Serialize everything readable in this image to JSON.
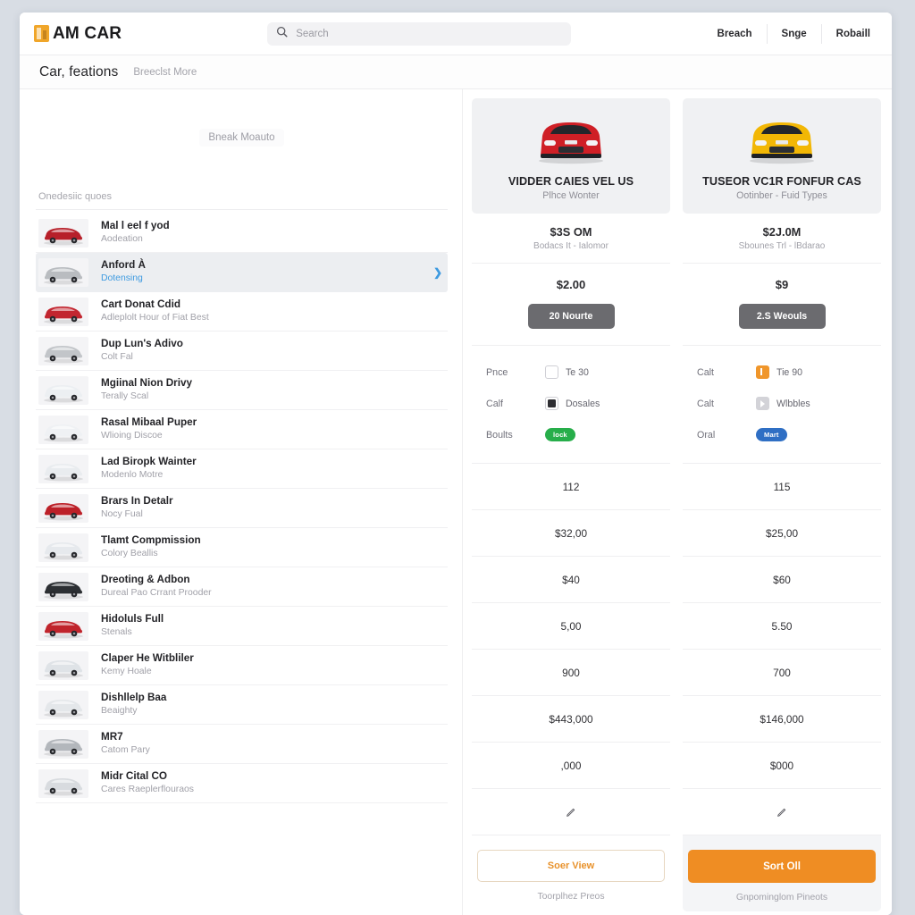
{
  "header": {
    "brand": "AM CAR",
    "brand_mark_color": "#f0a62a",
    "search_placeholder": "Search",
    "search_value": "",
    "nav": [
      {
        "label": "Breach"
      },
      {
        "label": "Snge"
      },
      {
        "label": "Robaill"
      }
    ]
  },
  "subheader": {
    "title": "Car, feations",
    "link": "Breeclst More"
  },
  "left_panel": {
    "hero_chip": "Bneak Moauto",
    "section_label": "Onedesiic quoes",
    "cars": [
      {
        "title": "Mal l eel f yod",
        "sub": "Aodeation",
        "color": "#b7202a",
        "selected": false,
        "link": false
      },
      {
        "title": "Anford À",
        "sub": "Dotensing",
        "color": "#b9bcc0",
        "selected": true,
        "link": true
      },
      {
        "title": "Cart Donat Cdid",
        "sub": "Adleplolt Hour of Fiat Best",
        "color": "#c22630",
        "selected": false,
        "link": false
      },
      {
        "title": "Dup Lun's Adivo",
        "sub": "Colt Fal",
        "color": "#c2c5c9",
        "selected": false,
        "link": false
      },
      {
        "title": "Mgiinal Nion Drivy",
        "sub": "Terally Scal",
        "color": "#eceff2",
        "selected": false,
        "link": false
      },
      {
        "title": "Rasal Mibaal Puper",
        "sub": "Wlioing Discoe",
        "color": "#eff1f4",
        "selected": false,
        "link": false
      },
      {
        "title": "Lad Biropk Wainter",
        "sub": "Modenlo Motre",
        "color": "#e9ecef",
        "selected": false,
        "link": false
      },
      {
        "title": "Brars In Detalr",
        "sub": "Nocy Fual",
        "color": "#bc2028",
        "selected": false,
        "link": false
      },
      {
        "title": "Tlamt Compmission",
        "sub": "Colory Beallis",
        "color": "#e6e9ed",
        "selected": false,
        "link": false
      },
      {
        "title": "Dreoting & Adbon",
        "sub": "Dureal Pao Crrant Prooder",
        "color": "#2c2f33",
        "selected": false,
        "link": false
      },
      {
        "title": "Hidoluls Full",
        "sub": "Stenals",
        "color": "#c0242c",
        "selected": false,
        "link": false
      },
      {
        "title": "Claper He Witbliler",
        "sub": "Kemy Hoale",
        "color": "#dfe3e7",
        "selected": false,
        "link": false
      },
      {
        "title": "Dishllelp Baa",
        "sub": "Beaighty",
        "color": "#e4e7ea",
        "selected": false,
        "link": false
      },
      {
        "title": "MR7",
        "sub": "Catom Pary",
        "color": "#b3b7bc",
        "selected": false,
        "link": false
      },
      {
        "title": "Midr Cital CO",
        "sub": "Cares Raeplerflouraos",
        "color": "#d8dbdf",
        "selected": false,
        "link": false
      }
    ]
  },
  "compare": [
    {
      "car_color": "#cf1f26",
      "name": "VIDDER CAIES VEL US",
      "sub": "Plhce Wonter",
      "price": "$3S OM",
      "price_sub": "Bodacs It - Ialomor",
      "mid_value": "$2.00",
      "mid_button": "20 Nourte",
      "options": [
        {
          "label": "Pnce",
          "control": "checkbox-empty",
          "text": "Te 30"
        },
        {
          "label": "Calf",
          "control": "checkbox-filled",
          "text": "Dosales"
        },
        {
          "label": "Boults",
          "control": "pill-green",
          "text": "",
          "pill_label": "lock"
        }
      ],
      "specs": [
        "112",
        "$32,00",
        "$40",
        "5,00",
        "900",
        "$443,000",
        ",000"
      ],
      "edit_icon": "pencil-icon",
      "footer_button": "Soer View",
      "footer_note": "Toorplhez Preos",
      "footer_style": "outline"
    },
    {
      "car_color": "#f2b705",
      "name": "TUSEOR VC1R FONFUR CAS",
      "sub": "Ootinber - Fuid Types",
      "price": "$2J.0M",
      "price_sub": "Sbounes Trl - lBdarao",
      "mid_value": "$9",
      "mid_button": "2.S Weouls",
      "options": [
        {
          "label": "Calt",
          "control": "checkbox-orange",
          "text": "Tie 90"
        },
        {
          "label": "Calt",
          "control": "checkbox-grey",
          "text": "Wlbbles"
        },
        {
          "label": "Oral",
          "control": "pill-blue",
          "text": "",
          "pill_label": "Mart"
        }
      ],
      "specs": [
        "115",
        "$25,00",
        "$60",
        "5.50",
        "700",
        "$146,000",
        "$000"
      ],
      "edit_icon": "pencil-icon",
      "footer_button": "Sort Oll",
      "footer_note": "Gnpominglom Pineots",
      "footer_style": "solid"
    }
  ],
  "colors": {
    "accent_orange": "#ef8d23",
    "link_blue": "#3d9ae0",
    "page_bg": "#d8dde4"
  }
}
